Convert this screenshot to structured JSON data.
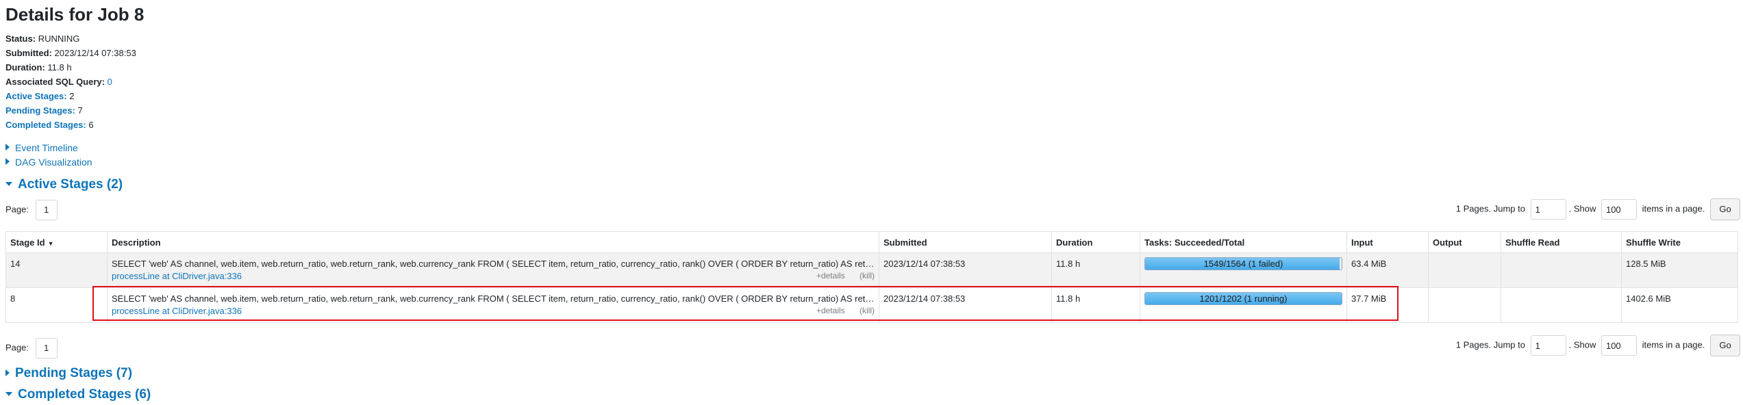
{
  "page": {
    "title": "Details for Job 8"
  },
  "summary": {
    "status_label": "Status:",
    "status_value": "RUNNING",
    "submitted_label": "Submitted:",
    "submitted_value": "2023/12/14 07:38:53",
    "duration_label": "Duration:",
    "duration_value": "11.8 h",
    "sql_label": "Associated SQL Query:",
    "sql_value": "0",
    "active_label": "Active Stages:",
    "active_value": "2",
    "pending_label": "Pending Stages:",
    "pending_value": "7",
    "completed_label": "Completed Stages:",
    "completed_value": "6"
  },
  "toggles": {
    "event_timeline": "Event Timeline",
    "dag_visualization": "DAG Visualization"
  },
  "sections": {
    "active": "Active Stages (2)",
    "pending": "Pending Stages (7)",
    "completed": "Completed Stages (6)"
  },
  "pager": {
    "page_label": "Page:",
    "page_value": "1",
    "pages_text": "1 Pages. Jump to",
    "jump_value": "1",
    "show_text": ". Show",
    "show_value": "100",
    "items_text": "items in a page.",
    "go_label": "Go"
  },
  "table": {
    "headers": [
      "Stage Id",
      "Description",
      "Submitted",
      "Duration",
      "Tasks: Succeeded/Total",
      "Input",
      "Output",
      "Shuffle Read",
      "Shuffle Write"
    ],
    "sort_icon": "sort-desc-icon",
    "rows": [
      {
        "stage_id": "14",
        "description": "SELECT 'web' AS channel, web.item, web.return_ratio, web.return_rank, web.currency_rank FROM ( SELECT item, return_ratio, currency_ratio, rank() OVER ( ORDER BY return_ratio) AS return_rank, rank() OVER ( ORDER BY currency_ratio) AS currency_rank",
        "call_site": "processLine at CliDriver.java:336",
        "details": "+details",
        "kill": "(kill)",
        "submitted": "2023/12/14 07:38:53",
        "duration": "11.8 h",
        "tasks_text": "1549/1564 (1 failed)",
        "tasks_progress": 0.99,
        "input": "63.4 MiB",
        "output": "",
        "shuffle_read": "",
        "shuffle_write": "128.5 MiB"
      },
      {
        "stage_id": "8",
        "description": "SELECT 'web' AS channel, web.item, web.return_ratio, web.return_rank, web.currency_rank FROM ( SELECT item, return_ratio, currency_ratio, rank() OVER ( ORDER BY return_ratio) AS return_rank, rank() OVER ( ORDER BY currency_ratio) AS currency_rank",
        "call_site": "processLine at CliDriver.java:336",
        "details": "+details",
        "kill": "(kill)",
        "submitted": "2023/12/14 07:38:53",
        "duration": "11.8 h",
        "tasks_text": "1201/1202 (1 running)",
        "tasks_progress": 0.999,
        "input": "37.7 MiB",
        "output": "",
        "shuffle_read": "",
        "shuffle_write": "1402.6 MiB"
      }
    ]
  },
  "colors": {
    "link": "#0e74b8",
    "progress_fill": "#44aae8",
    "highlight": "#e0101a"
  }
}
